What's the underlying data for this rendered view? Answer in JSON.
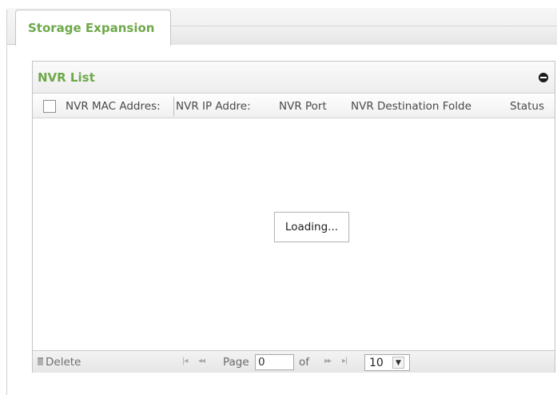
{
  "tabs": [
    {
      "label": "Storage Expansion",
      "active": true
    }
  ],
  "panel": {
    "title": "NVR List",
    "collapse_icon": "collapse-circle-icon"
  },
  "grid": {
    "columns": [
      {
        "label": "NVR MAC Addres:"
      },
      {
        "label": "NVR IP Addre:"
      },
      {
        "label": "NVR Port"
      },
      {
        "label": "NVR Destination Folde"
      },
      {
        "label": "Status"
      }
    ],
    "loading_text": "Loading..."
  },
  "pager": {
    "delete_label": "Delete",
    "first_icon": "first-page-icon",
    "prev_icon": "prev-page-icon",
    "next_icon": "next-page-icon",
    "last_icon": "last-page-icon",
    "page_label": "Page",
    "page_value": "0",
    "of_label": "of",
    "page_size": "10"
  },
  "colors": {
    "accent_green": "#6ea84a"
  }
}
